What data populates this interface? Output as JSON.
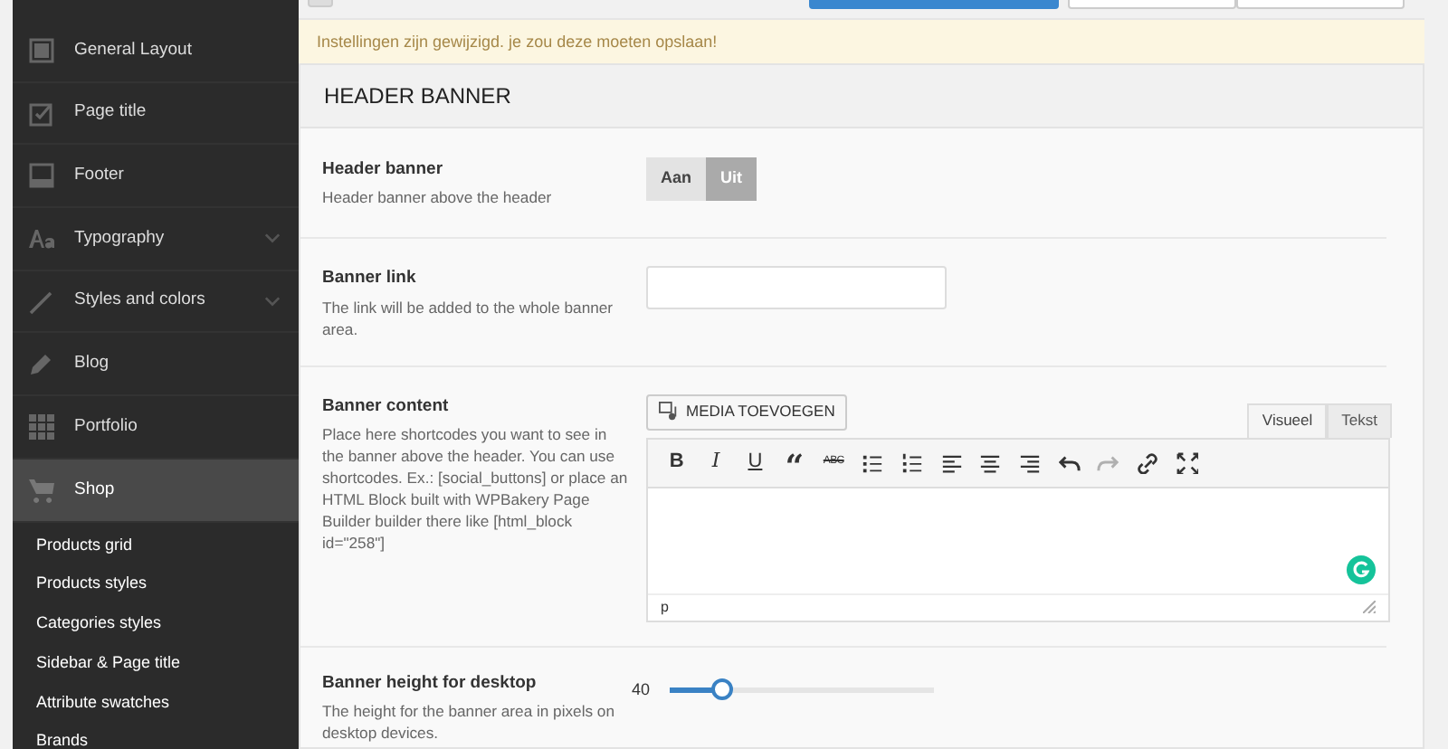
{
  "top_buttons": [
    {
      "kind": "small"
    },
    {
      "kind": "primary"
    },
    {
      "kind": "default"
    },
    {
      "kind": "default"
    }
  ],
  "sidebar": {
    "items": [
      {
        "label": "General Layout",
        "kind": "layout",
        "expandable": false,
        "selected": false
      },
      {
        "label": "Page title",
        "kind": "check",
        "expandable": false,
        "selected": false
      },
      {
        "label": "Footer",
        "kind": "footer",
        "expandable": false,
        "selected": false
      },
      {
        "label": "Typography",
        "kind": "font",
        "expandable": true,
        "selected": false
      },
      {
        "label": "Styles and colors",
        "kind": "brush",
        "expandable": true,
        "selected": false
      },
      {
        "label": "Blog",
        "kind": "pencil",
        "expandable": false,
        "selected": false
      },
      {
        "label": "Portfolio",
        "kind": "grid",
        "expandable": false,
        "selected": false
      },
      {
        "label": "Shop",
        "kind": "cart",
        "expandable": false,
        "selected": true,
        "children": [
          {
            "label": "Products grid"
          },
          {
            "label": "Products styles"
          },
          {
            "label": "Categories styles"
          },
          {
            "label": "Sidebar & Page title"
          },
          {
            "label": "Attribute swatches"
          },
          {
            "label": "Brands"
          }
        ]
      }
    ]
  },
  "notice": "Instellingen zijn gewijzigd. je zou deze moeten opslaan!",
  "section_title": "HEADER BANNER",
  "fields": [
    {
      "kind": "toggle",
      "label": "Header banner",
      "description": "Header banner above the header",
      "options": [
        {
          "label": "Aan",
          "selected": false
        },
        {
          "label": "Uit",
          "selected": true
        }
      ]
    },
    {
      "kind": "text",
      "label": "Banner link",
      "description": "The link will be added to the whole banner area."
    },
    {
      "kind": "editor",
      "label": "Banner content",
      "description": "Place here shortcodes you want to see in the banner above the header. You can use shortcodes. Ex.: [social_buttons] or place an HTML Block built with WPBakery Page Builder builder there like [html_block id=\"258\"]",
      "media_button": "MEDIA TOEVOEGEN",
      "tabs": [
        {
          "label": "Visueel",
          "selected": true
        },
        {
          "label": "Tekst",
          "selected": false
        }
      ],
      "toolbar": [
        {
          "kind": "bold",
          "label": "B"
        },
        {
          "kind": "italic",
          "label": "I"
        },
        {
          "kind": "underline",
          "label": "U"
        },
        {
          "kind": "quote",
          "label": "“"
        },
        {
          "kind": "strike",
          "label": "ABC"
        },
        {
          "kind": "bullets"
        },
        {
          "kind": "numbers"
        },
        {
          "kind": "align-left"
        },
        {
          "kind": "align-center"
        },
        {
          "kind": "align-right"
        },
        {
          "kind": "undo"
        },
        {
          "kind": "redo",
          "disabled": true
        },
        {
          "kind": "link"
        },
        {
          "kind": "fullscreen"
        }
      ],
      "path": "p"
    },
    {
      "kind": "slider",
      "label": "Banner height for desktop",
      "description": "The height for the banner area in pixels on desktop devices.",
      "value": "40",
      "level": 0.2
    }
  ]
}
